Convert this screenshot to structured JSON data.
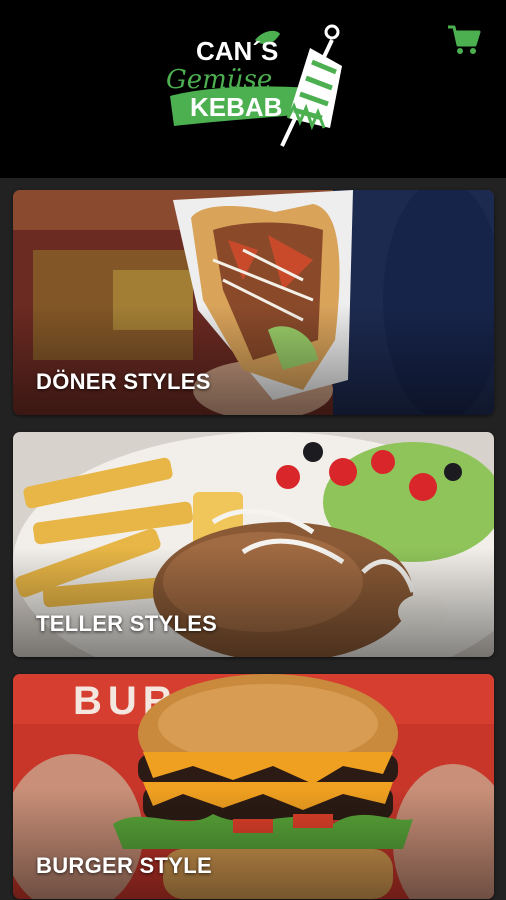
{
  "header": {
    "logo": {
      "line1": "CAN´S",
      "line2": "Gemüse",
      "line3": "KEBAB"
    },
    "cart_icon": "shopping-cart-icon",
    "accent_color": "#4caf50"
  },
  "categories": [
    {
      "label": "DÖNER STYLES"
    },
    {
      "label": "TELLER STYLES"
    },
    {
      "label": "BURGER STYLE"
    }
  ],
  "burger_sign_text": "BURGER"
}
